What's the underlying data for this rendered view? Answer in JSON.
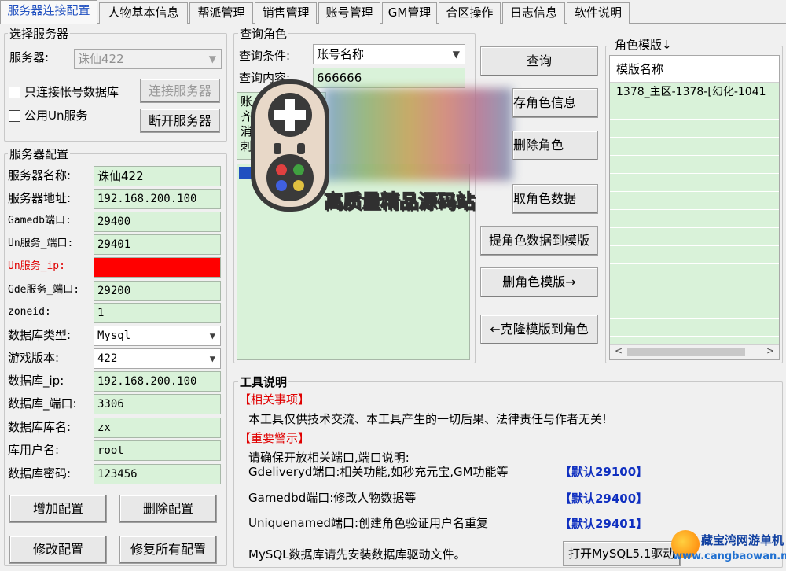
{
  "tabs": [
    "服务器连接配置",
    "人物基本信息",
    "帮派管理",
    "销售管理",
    "账号管理",
    "GM管理",
    "合区操作",
    "日志信息",
    "软件说明"
  ],
  "select_server": {
    "title": "选择服务器",
    "server_label": "服务器:",
    "server_value": "诛仙422",
    "only_account_db_label": "只连接帐号数据库",
    "public_un_label": "公用Un服务",
    "connect_button": "连接服务器",
    "disconnect_button": "断开服务器"
  },
  "server_config": {
    "title": "服务器配置",
    "fields": [
      {
        "label": "服务器名称:",
        "value": "诛仙422"
      },
      {
        "label": "服务器地址:",
        "value": "192.168.200.100"
      },
      {
        "label": "Gamedb端口:",
        "value": "29400"
      },
      {
        "label": "Un服务_端口:",
        "value": "29401"
      },
      {
        "label": "Un服务_ip:",
        "value": ""
      },
      {
        "label": "Gde服务_端口:",
        "value": "29200"
      },
      {
        "label": "zoneid:",
        "value": "1"
      },
      {
        "label": "数据库类型:",
        "value": "Mysql"
      },
      {
        "label": "游戏版本:",
        "value": "422"
      },
      {
        "label": "数据库_ip:",
        "value": "192.168.200.100"
      },
      {
        "label": "数据库_端口:",
        "value": "3306"
      },
      {
        "label": "数据库库名:",
        "value": "zx"
      },
      {
        "label": "库用户名:",
        "value": "root"
      },
      {
        "label": "数据库密码:",
        "value": "123456"
      }
    ],
    "add_button": "增加配置",
    "delete_button": "删除配置",
    "modify_button": "修改配置",
    "repair_button": "修复所有配置"
  },
  "query_role": {
    "title": "查询角色",
    "condition_label": "查询条件:",
    "condition_value": "账号名称",
    "content_label": "查询内容:",
    "content_value": "666666",
    "result_fragments": [
      "账",
      "齐",
      "消",
      "刺"
    ]
  },
  "actions": {
    "query": "查询",
    "save_role": "存角色信息",
    "delete_role": "删除角色",
    "role_data": "取角色数据",
    "extract_template": "提角色数据到模版",
    "delete_template": "删角色模版→",
    "clone_template": "←克隆模版到角色"
  },
  "templates": {
    "title": "角色模版↓",
    "header": "模版名称",
    "rows": [
      "1378_主区-1378-[幻化-1041"
    ]
  },
  "tool_notes": {
    "title": "工具说明",
    "section1": "【相关事项】",
    "disclaimer": "本工具仅供技术交流、本工具产生的一切后果、法律责任与作者无关!",
    "section2": "【重要警示】",
    "ports_intro": "请确保开放相关端口,端口说明:",
    "gdelivery": "Gdeliveryd端口:相关功能,如秒充元宝,GM功能等",
    "gdelivery_default": "【默认29100】",
    "gamedb": "Gamedbd端口:修改人物数据等",
    "gamedb_default": "【默认29400】",
    "uniquenamed": "Uniquenamed端口:创建角色验证用户名重复",
    "uniquenamed_default": "【默认29401】",
    "mysql_note": "MySQL数据库请先安装数据库驱动文件。",
    "mysql_button": "打开MySQL5.1驱动"
  },
  "watermark": {
    "text": "高质量精品源码站"
  },
  "corner_logo": {
    "name": "藏宝湾网游单机",
    "url": "www.cangbaowan.net"
  },
  "colors": {
    "field_bg": "#d9f2d9",
    "error_field": "#ff0000",
    "warning_text": "#e00000",
    "default_port_text": "#1030c0",
    "active_tab_text": "#2050c0"
  }
}
